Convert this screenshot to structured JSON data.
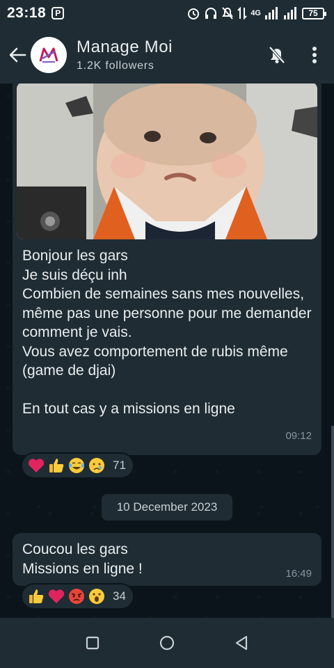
{
  "status_bar": {
    "time": "23:18",
    "app_badge": "P",
    "network": "4G",
    "battery": "75"
  },
  "header": {
    "channel_name": "Manage Moi",
    "followers": "1.2K followers",
    "avatar_icon": "manage-moi-logo",
    "back_icon": "arrow-left-icon",
    "mute_icon": "bell-off-icon",
    "menu_icon": "more-vertical-icon"
  },
  "messages": [
    {
      "image": "crying-baby-photo",
      "text": "Bonjour les gars\nJe suis déçu inh\nCombien de semaines sans mes nouvelles, même pas une personne pour me demander comment je vais.\nVous avez comportement de rubis même (game de djai)\n\nEn tout cas y a missions en ligne",
      "time": "09:12",
      "reactions": [
        "heart",
        "thumbs-up",
        "tears-of-joy",
        "sad-tear"
      ],
      "reaction_count": "71"
    },
    {
      "date_separator": "10 December 2023",
      "text": "Coucou les gars\nMissions en ligne !",
      "time": "16:49",
      "reactions": [
        "thumbs-up",
        "heart",
        "angry",
        "astonished"
      ],
      "reaction_count": "34"
    }
  ],
  "colors": {
    "background": "#0b141a",
    "bubble": "#1f2c34",
    "text": "#e9edef",
    "meta": "#8696a0"
  }
}
